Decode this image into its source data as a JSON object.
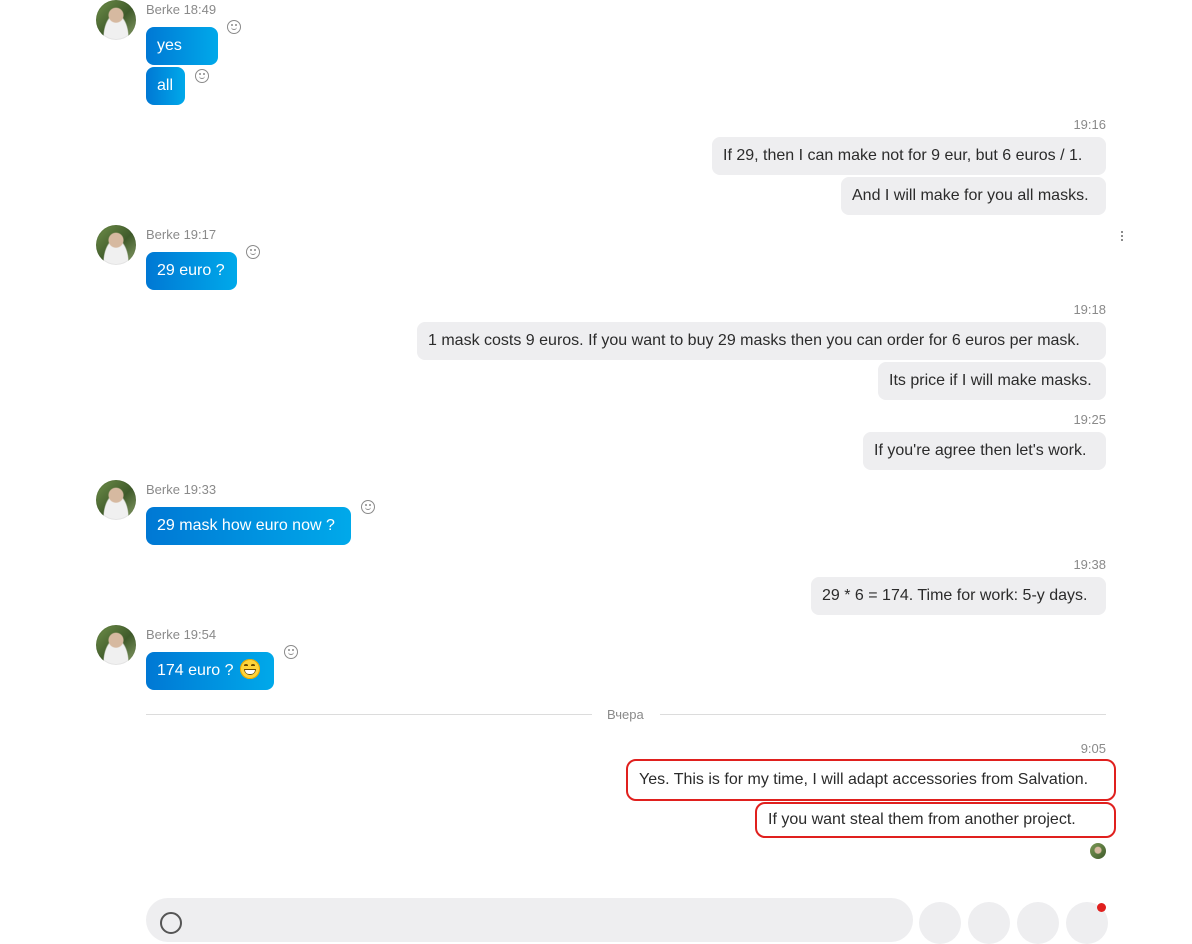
{
  "messages": [
    {
      "id": "m1",
      "sender": "Berke 18:49",
      "bubbles": [
        "yes",
        "all"
      ]
    },
    {
      "id": "o1",
      "time": "19:16",
      "bubbles": [
        "If 29, then I can make not for 9 eur, but 6 euros / 1.",
        "And I will make for you all masks."
      ]
    },
    {
      "id": "m2",
      "sender": "Berke 19:17",
      "bubbles": [
        "29 euro ?"
      ]
    },
    {
      "id": "o2",
      "time": "19:18",
      "bubbles": [
        "1 mask costs 9 euros. If you want to buy 29 masks then you can order for 6 euros per mask.",
        "Its price if I will make masks."
      ]
    },
    {
      "id": "o3",
      "time": "19:25",
      "bubbles": [
        "If you're agree then let's work."
      ]
    },
    {
      "id": "m3",
      "sender": "Berke 19:33",
      "bubbles": [
        "29 mask how euro now ?"
      ]
    },
    {
      "id": "o4",
      "time": "19:38",
      "bubbles": [
        "29 * 6 = 174. Time for work: 5-y days."
      ]
    },
    {
      "id": "m4",
      "sender": "Berke 19:54",
      "bubbles": [
        "174 euro ?"
      ]
    },
    {
      "id": "o5",
      "time": "9:05",
      "bubbles": [
        "Yes. This is for my time, I will adapt accessories from Salvation.",
        "If you want steal them from another project."
      ]
    }
  ],
  "divider": {
    "label": "Вчера"
  },
  "emoji": {
    "icon": "grinning-face-icon"
  },
  "colors": {
    "incoming_start": "#0078d4",
    "incoming_end": "#00a9ea",
    "outgoing_bg": "#eeeef0",
    "highlight": "#e0201e"
  }
}
